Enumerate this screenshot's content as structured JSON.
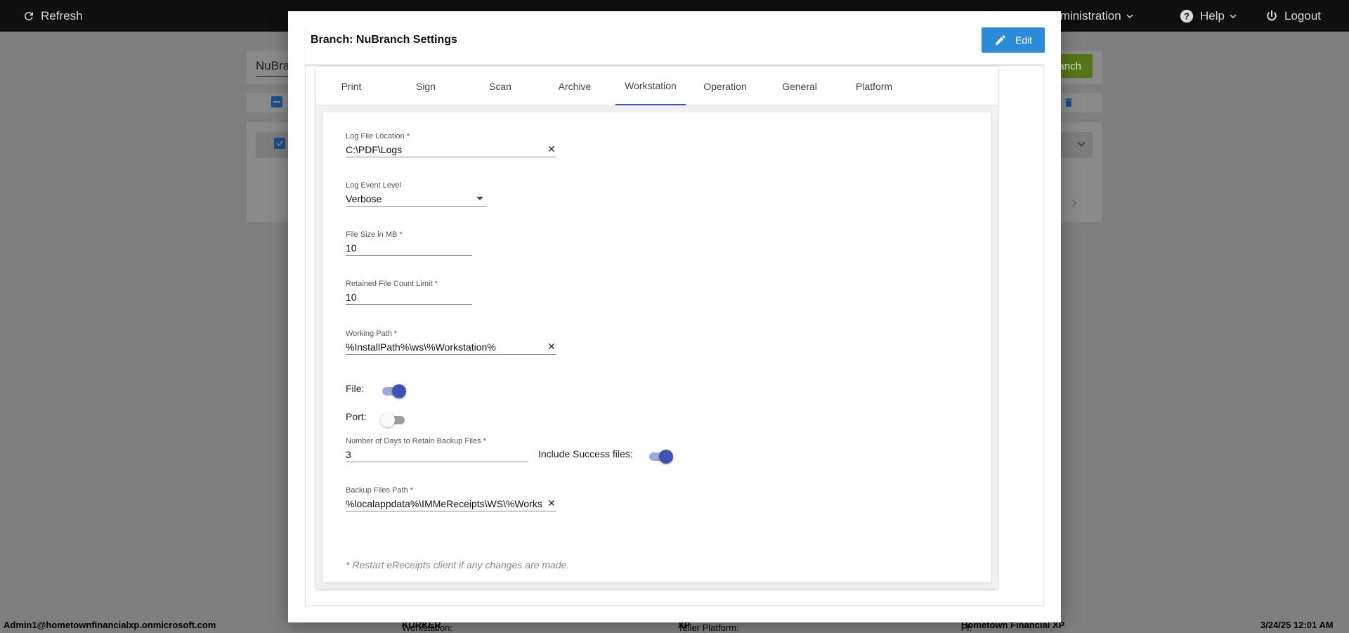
{
  "topbar": {
    "refresh_label": "Refresh",
    "admin_label": "Administration",
    "help_label": "Help",
    "logout_label": "Logout"
  },
  "background": {
    "search_value": "NuBra",
    "green_button_partial": "anch"
  },
  "modal": {
    "title": "Branch: NuBranch Settings",
    "edit_label": "Edit",
    "tabs": [
      "Print",
      "Sign",
      "Scan",
      "Archive",
      "Workstation",
      "Operation",
      "General",
      "Platform"
    ],
    "active_tab": "Workstation",
    "form": {
      "log_file_location": {
        "label": "Log File Location *",
        "value": "C:\\PDF\\Logs"
      },
      "log_event_level": {
        "label": "Log Event Level",
        "value": "Verbose"
      },
      "file_size": {
        "label": "File Size in MB *",
        "value": "10"
      },
      "retained_count": {
        "label": "Retained File Count Limit *",
        "value": "10"
      },
      "working_path": {
        "label": "Working Path *",
        "value": "%InstallPath%\\ws\\%Workstation%"
      },
      "file_toggle": {
        "label": "File:",
        "on": true
      },
      "port_toggle": {
        "label": "Port:",
        "on": false
      },
      "backup_days": {
        "label": "Number of Days to Retain Backup Files *",
        "value": "3"
      },
      "include_success": {
        "label": "Include Success files:",
        "on": true
      },
      "backup_path": {
        "label": "Backup Files Path *",
        "value": "%localappdata%\\IMMeReceipts\\WS\\%Works"
      },
      "note": "* Restart eReceipts client if any changes are made."
    }
  },
  "status": {
    "user": "Admin1@hometownfinancialxp.onmicrosoft.com",
    "workstation_label": "Workstation: ",
    "workstation_value": "KURKER",
    "teller_label": "Teller Platform: ",
    "teller_value": "XP",
    "fi_label": "FI: ",
    "fi_value": "Hometown Financial XP",
    "datetime": "3/24/25 12:01 AM"
  },
  "colors": {
    "accent": "#3f51b5",
    "edit_button": "#2d8ad8",
    "topbar": "#0f0f0f"
  }
}
